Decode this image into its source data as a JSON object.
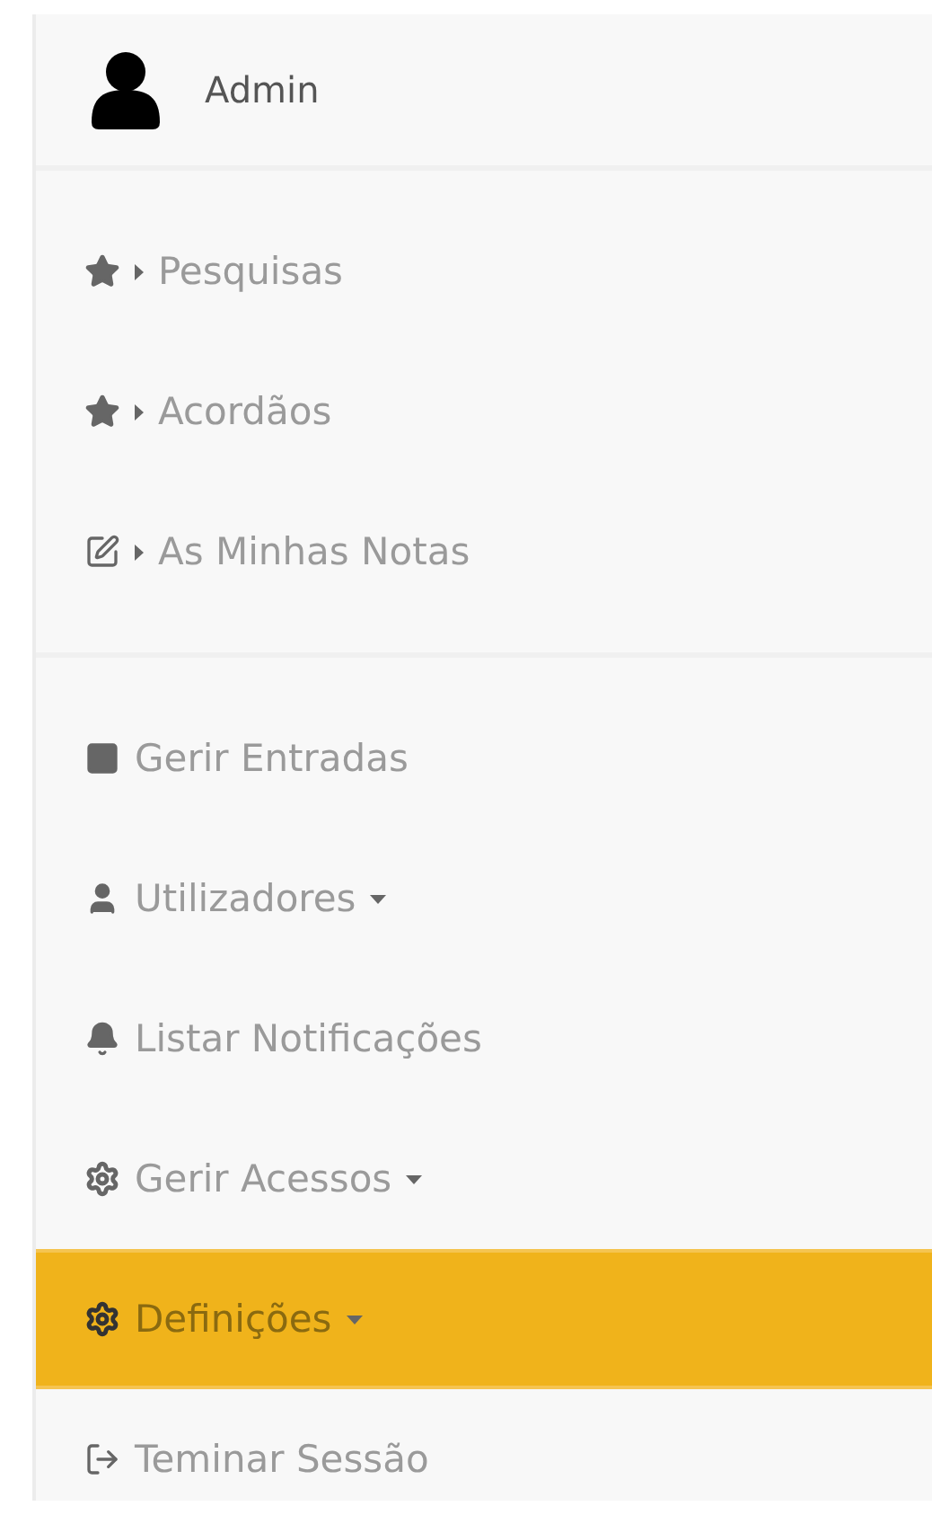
{
  "user": {
    "name": "Admin"
  },
  "sections": [
    {
      "items": [
        {
          "label": "Pesquisas",
          "kind": "shortcut",
          "selected": false
        },
        {
          "label": "Acordãos",
          "kind": "shortcut",
          "selected": false
        },
        {
          "label": "As Minhas Notas",
          "kind": "shortcut",
          "selected": false
        }
      ]
    },
    {
      "items": [
        {
          "label": "Gerir Entradas",
          "kind": "link",
          "selected": false
        },
        {
          "label": "Utilizadores",
          "kind": "dropdown",
          "selected": false
        },
        {
          "label": "Listar Notificações",
          "kind": "link",
          "selected": false
        },
        {
          "label": "Gerir Acessos",
          "kind": "dropdown",
          "selected": false
        },
        {
          "label": "Definições",
          "kind": "dropdown",
          "selected": true
        },
        {
          "label": "Teminar Sessão",
          "kind": "link",
          "selected": false
        }
      ]
    }
  ]
}
